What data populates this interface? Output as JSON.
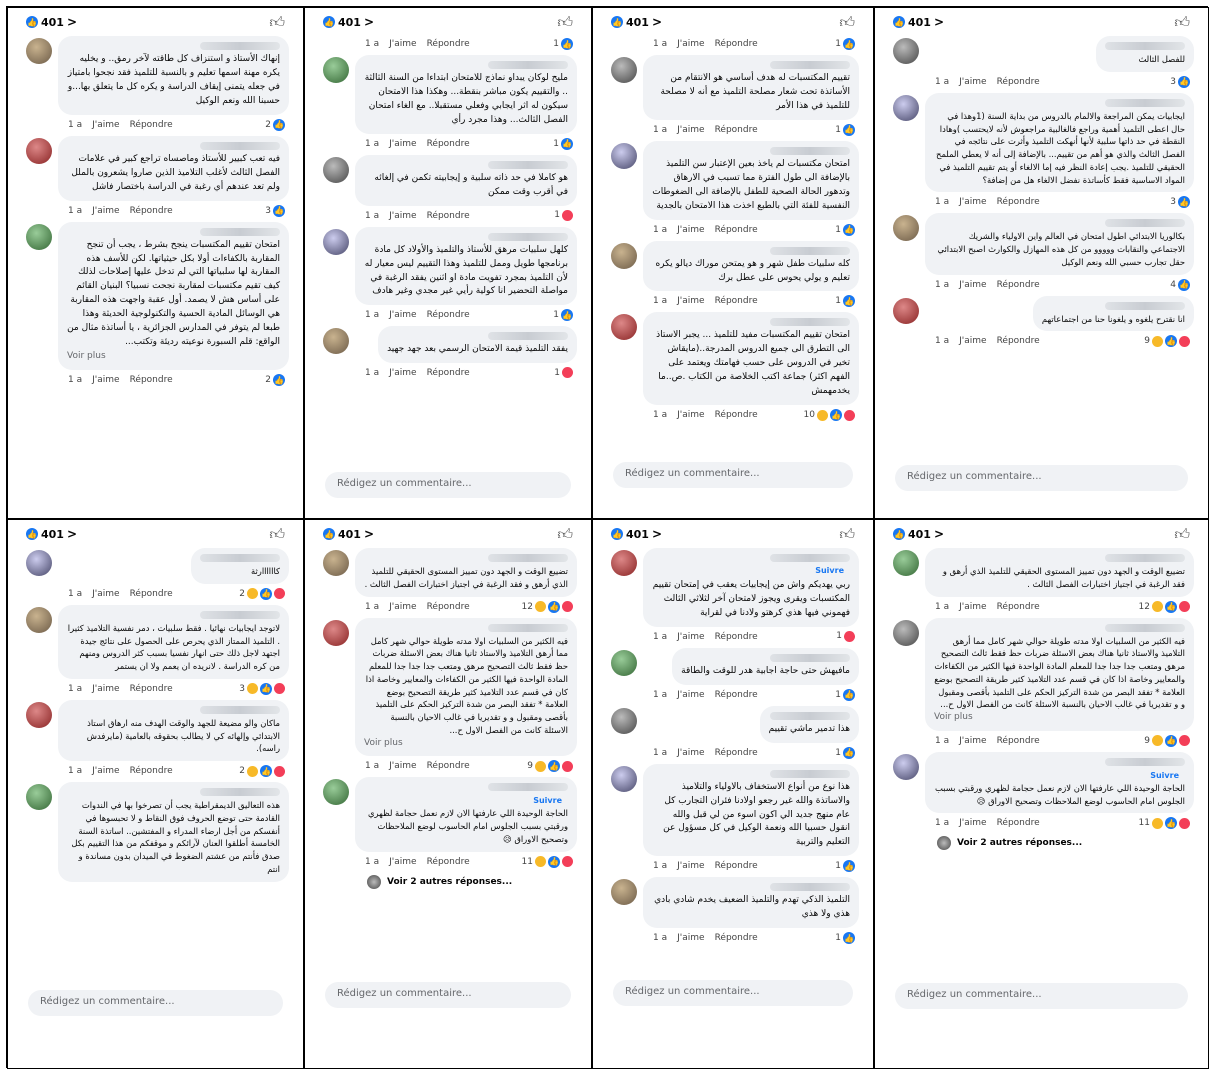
{
  "common": {
    "reaction_count": "401",
    "time": "1 a",
    "like": "J'aime",
    "reply": "Répondre",
    "write_placeholder": "Rédigez un commentaire...",
    "see_more": "Voir plus",
    "follow": "Suivre",
    "colors": {
      "brand": "#1877f2",
      "bubble": "#f0f2f5"
    }
  },
  "panels": [
    {
      "comments": [
        {
          "text": "إنهاك الأستاذ و استنزاف كل طاقته لآخر رمق.. و يخليه يكره مهنة اسمها تعليم و بالنسبة للتلميذ فقد نجحوا بامتياز في جعله يتمنى إيقاف الدراسة و يكره كل ما يتعلق بها...و حسبنا الله ونعم الوكيل",
          "count": "2"
        },
        {
          "text": "فيه تعب كبيير للأستاذ وماصساه تراجع كبير في علامات الفصل الثالث لأغلب التلاميذ الذين صاروا يشعرون بالملل ولم تعد عندهم أي رغبة في الدراسة باختصار فاشل",
          "count": "3"
        },
        {
          "text": "امتحان تقييم المكتسبات ينجح بشرط ، يجب أن تنجح المقاربة بالكفاءات أولا بكل حيثياتها. لكن للأسف هذه المقاربة لها سلبياتها التي لم تدخل عليها إصلاحات لذلك كيف تقيم مكتسبات لمقاربة نجحت نسبيا؟ البنيان القائم على أساس هش لا يصمد. أول عقبة واجهت هذه المقاربة هي الوسائل المادية الحسية والتكنولوجية الحديثة وهذا طبعا لم يتوفر في المدارس الجزائرية ، يا أساتذة مثال من الواقع: قلم السبورة نوعيته رديئة وتكتب...",
          "more": true,
          "count": "2"
        }
      ]
    },
    {
      "comments": [
        {
          "text": "",
          "count": "1",
          "noBubble": true
        },
        {
          "text": "مليح لوكان يبداو نماذج للامتحان ابتداءا من السنة الثالثة .. والتقييم يكون مباشر بنقطة... وهكذا هذا الامتحان سيكون له اثر ايجابي وفعلي مستقبلا.. مع الغاء امتحان الفصل الثالث... وهذا مجرد رأي",
          "count": "1"
        },
        {
          "text": "هو كاملا في حد ذاته سلبية و إيجابيته تكمن في إلغائه في أقرب وقت ممكن",
          "count": "1",
          "love": true
        },
        {
          "text": "كلهل سلبيات مرهق للأستاذ والتلميذ والأولاد كل مادة برنامجها طويل وممل للتلميذ وهذا التقييم ليس معيار له لأن التلميذ بمجرد تفويت مادة او اثنين يفقد الرغبة في مواصلة التحضير انا كولية رأيي غير مجدي وغير هادف",
          "count": "1"
        },
        {
          "text": "يفقد التلميذ قيمة الامتحان الرسمي بعد جهد جهيد",
          "count": "1",
          "love": true
        }
      ]
    },
    {
      "comments": [
        {
          "text": "",
          "count": "1",
          "noBubble": true
        },
        {
          "text": "تقييم المكتسبات له هدف أساسي هو الانتقام من الأساتذة تحت شعار مصلحة التلميذ مع أنه لا مصلحة للتلميذ في هذا الأمر",
          "count": "1"
        },
        {
          "text": "امتحان مكتسبات لم ياخذ بعين الإعتبار سن التلميذ بالإضافة الى طول الفترة مما تسبب في الارهاق وتدهور الحالة الصحية للطفل بالإضافة الى الضغوطات النفسية للفئة التي بالطبع اخذت هذا الامتحان بالجدية",
          "count": "1"
        },
        {
          "text": "كله سلبيات طفل شهر و هو يمتحن موراك ديالو يكره تعليم و يولي يحوس على عطل برك",
          "count": "1"
        },
        {
          "text": "امتحان تقييم المكتسبات مفيد للتلميذ ... يجبر الاستاذ الى التطرق الى جميع الدروس المدرجة..(مايقاش تخير في الدروس على حسب فهامتك ويعتمد على الفهم اكثر) جماعة اكتب الخلاصة من الكتاب .ص..ما يخدمهمش",
          "count": "10",
          "mixed": true
        }
      ]
    },
    {
      "comments": [
        {
          "text": "للفصل الثالث",
          "count": "3"
        },
        {
          "text": "ايجابيات يمكن المراجعة والالمام بالدروس من بداية السنة (1وهذا في حال اعطى التلميذ أهمية وراجع فالغالبية مراجعوش لأنه لايحتسب )وهادا النقطة في حد ذاتها سلبية لأنها أنهكت التلميذ وأثرت على نتائجه في الفصل الثالث والذي هو أهم من تقييم... بالإضافة إلى أنه لا يعطي الملمح الحقيقي للتلميذ .يجب إعادة النظر فيه إما الالغاء أو يتم تقييم التلميذ في المواد الاساسية فقط كأساتذة نفضل الالغاء هل من إضافة؟",
          "count": "3"
        },
        {
          "text": "بكالوريا الابتدائي اطول امتحان في العالم واين الاولياء والشريك الاجتماعي والنقابات ووووو من كل هذه المهازل والكوارث اصبح الابتدائي حقل تجارب حسبي الله ونعم الوكيل",
          "count": "4"
        },
        {
          "text": "انا نقترح يلغوه و يلغونا حنا من اجتماعاتهم",
          "count": "9",
          "mixed": true
        }
      ]
    },
    {
      "comments": [
        {
          "text": "كاااااارثة",
          "count": "2",
          "mixed": true
        },
        {
          "text": "لاتوجد ايجابيات نهائيا . فقط سلبيات ، دمر نفسية التلاميذ كثيرا . التلميذ الممتاز الذي يحرص على الحصول على نتائج جيدة اجتهد لاجل ذلك حتى انهار نفسيا بسبب كثر الدروس ومنهم من كره الدراسة . لانريده ان يعمم ولا ان يستمر",
          "count": "3",
          "mixed": true
        },
        {
          "text": "ماكان والو مضيعة للجهد والوقت الهدف منه ارهاق استاذ الابتدائي وإلهائه كي لا يطالب بحقوقه بالعامية (مايرفدش راسه).",
          "count": "2",
          "mixed": true
        },
        {
          "text": "هذه التعاليق الديمقراطية يجب أن تصرخوا بها في الندوات القادمة حتى توضع الحروف فوق النقاط و لا تحبسوها في أنفسكم من أجل ارضاء المدراء و المفتشين.. اساتذة السنة الخامسة أطلقوا العنان لآرائكم و موقفكم من هذا التقييم بكل صدق فأنتم من عشتم الضغوط في الميدان بدون مساندة و انتم",
          "count": "",
          "noMeta": true
        }
      ]
    },
    {
      "comments": [
        {
          "text": "تضييع الوقت و الجهد دون تمييز المستوى الحقيقي للتلميذ الذي أرهق و فقد الرغبة في اجتياز اختبارات الفصل الثالث .",
          "count": "12",
          "mixed": true
        },
        {
          "text": "فيه الكثير من السلبيات اولا مدته طويلة حوالي شهر كامل مما أرهق التلاميذ والاستاذ ثانيا هناك بعض الاسئلة ضربات حظ فقط ثالث التصحيح مرهق ومتعب جدا جدا جدا للمعلم المادة الواحدة فيها الكثير من الكفاءات والمعايير وخاصة اذا كان في قسم عدد التلاميذ كثير طريقة التصحيح بوضع العلامة * تفقد البصر من شدة التركيز الحكم على التلميذ بأقصى ومقبول و و تقديريا في غالب الاحيان بالنسبة الاسئلة كانت من الفصل الاول ح...",
          "more": true,
          "count": "9",
          "mixed": true
        },
        {
          "text": "الحاجة الوحيدة اللي عارفتها الان لازم نعمل حجامة لظهري ورقبتي بسبب الجلوس امام الحاسوب لوضع الملاحظات وتصحيح الاوراق 😥",
          "follow": true,
          "count": "11",
          "mixed": true
        }
      ],
      "replies": "Voir 2 autres réponses..."
    },
    {
      "comments": [
        {
          "text": "ربي يهديكم واش من إيجابيات يعقب في إمتحان تقييم المكتسبات ويقرى ويجوز لامتحان آخر لثلاثي الثالث فهموني فيها هذي كرهتو ولادنا في لقراية",
          "follow": true,
          "count": "1",
          "love": true
        },
        {
          "text": "مافيهش حتى حاجة اجابية هدر للوقت والطاقة",
          "count": "1"
        },
        {
          "text": "هذا تدمير ماشي تقييم",
          "count": "1"
        },
        {
          "text": "هذا نوع من أنواع الاستخفاف بالاولياء والتلاميذ والاساتذة والله غير رجعو اولادنا فئران التجارب كل عام منهج جديد الي اكون اسوء من لي قبل والله انقول حسبيا الله ونعمة الوكيل في كل مسؤول عن التعليم والتربية",
          "count": "1"
        },
        {
          "text": "التلميذ الذكي تهدم والتلميذ الضعيف يخدم شادي بادي هذي ولا هذي",
          "count": "1"
        }
      ]
    },
    {
      "comments": [
        {
          "text": "تضييع الوقت و الجهد دون تمييز المستوى الحقيقي للتلميذ الذي أرهق و فقد الرغبة في اجتياز اختبارات الفصل الثالث .",
          "count": "12",
          "mixed": true
        },
        {
          "text": "فيه الكثير من السلبيات اولا مدته طويلة حوالي شهر كامل مما أرهق التلاميذ والاستاذ ثانيا هناك بعض الاسئلة ضربات حظ فقط ثالث التصحيح مرهق ومتعب جدا جدا جدا للمعلم المادة الواحدة فيها الكثير من الكفاءات والمعايير وخاصة اذا كان في قسم عدد التلاميذ كثير طريقة التصحيح بوضع العلامة * تفقد البصر من شدة التركيز الحكم على التلميذ بأقصى ومقبول و و تقديريا في غالب الاحيان بالنسبة الاسئلة كانت من الفصل الاول ح...",
          "more": true,
          "count": "9",
          "mixed": true
        },
        {
          "text": "الحاجة الوحيدة اللي عارفتها الان لازم نعمل حجامة لظهري ورقبتي بسبب الجلوس امام الحاسوب لوضع الملاحظات وتصحيح الاوراق 😥",
          "follow": true,
          "count": "11",
          "mixed": true
        }
      ],
      "replies": "Voir 2 autres réponses..."
    }
  ]
}
